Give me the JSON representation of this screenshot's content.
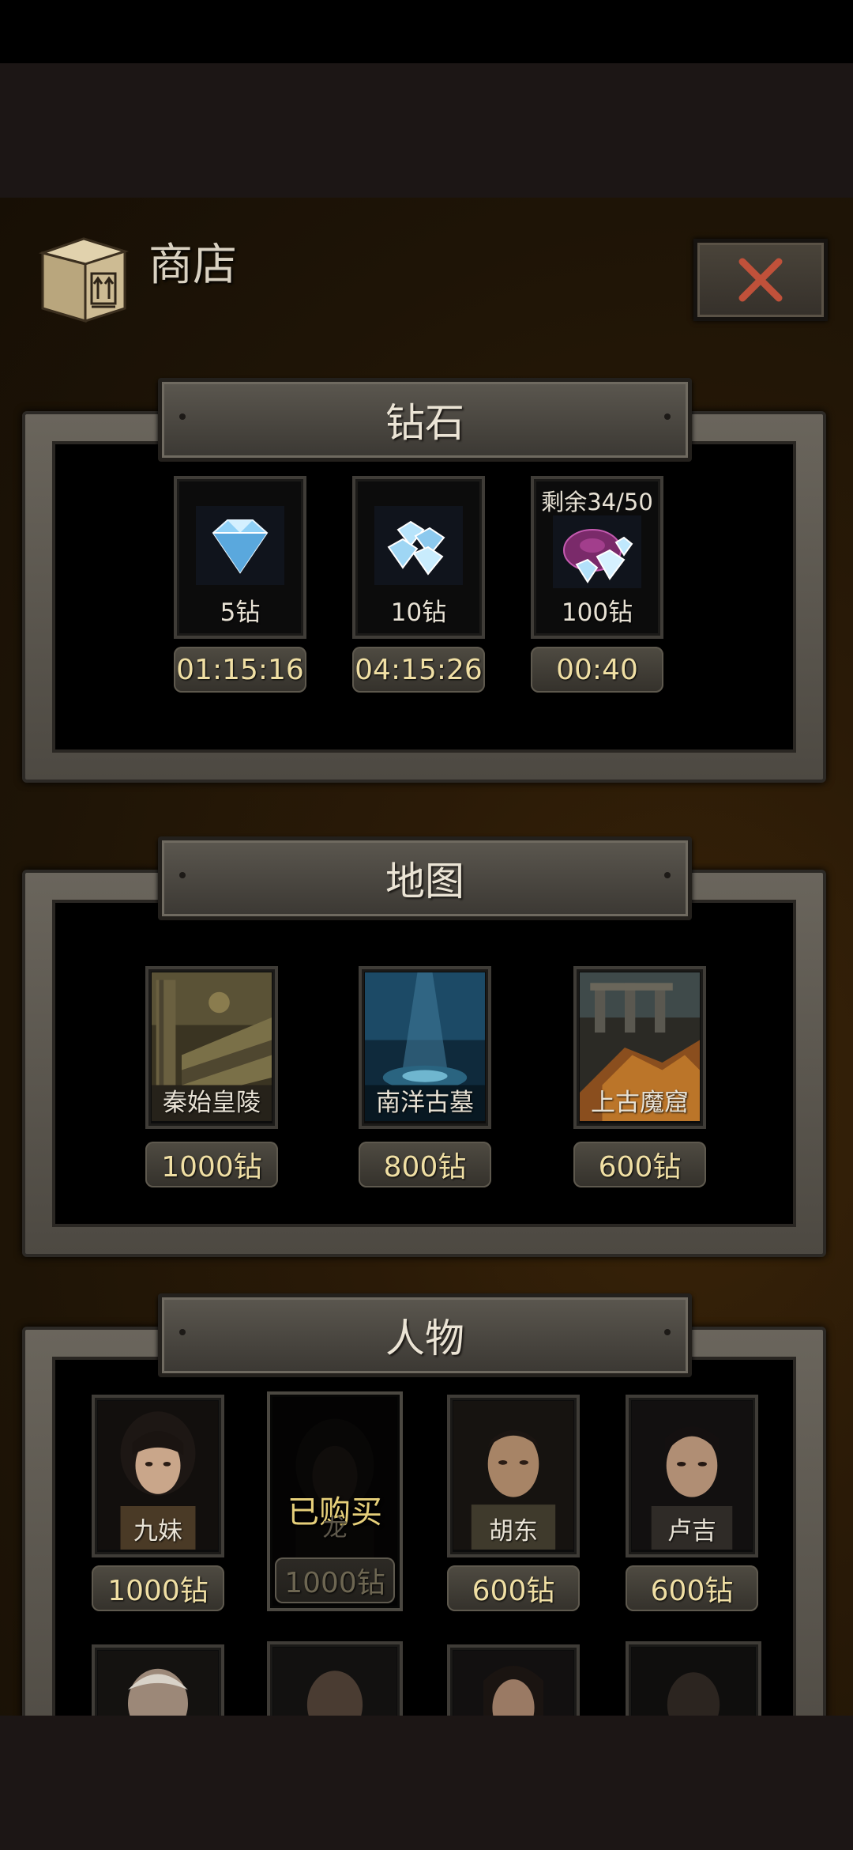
{
  "shop": {
    "title": "商店",
    "close_icon": "close-icon",
    "accent": "#c0513a"
  },
  "diamond_section": {
    "title": "钻石",
    "items": [
      {
        "label": "5钻",
        "timer": "01:15:16",
        "icon": "diamond-single-icon",
        "remaining": ""
      },
      {
        "label": "10钻",
        "timer": "04:15:26",
        "icon": "diamond-pile-icon",
        "remaining": ""
      },
      {
        "label": "100钻",
        "timer": "00:40",
        "icon": "diamond-bag-icon",
        "remaining": "剩余34/50"
      }
    ]
  },
  "map_section": {
    "title": "地图",
    "items": [
      {
        "name": "秦始皇陵",
        "price": "1000钻"
      },
      {
        "name": "南洋古墓",
        "price": "800钻"
      },
      {
        "name": "上古魔窟",
        "price": "600钻"
      }
    ]
  },
  "character_section": {
    "title": "人物",
    "items": [
      {
        "name": "九妹",
        "price": "1000钻",
        "status": ""
      },
      {
        "name": "龙",
        "price": "1000钻",
        "status": "已购买"
      },
      {
        "name": "胡东",
        "price": "600钻",
        "status": ""
      },
      {
        "name": "卢吉",
        "price": "600钻",
        "status": ""
      }
    ]
  },
  "colors": {
    "price_text": "#f0dfa4",
    "purchased_text": "#e6cf7a",
    "panel_frame": "#5a5650"
  }
}
